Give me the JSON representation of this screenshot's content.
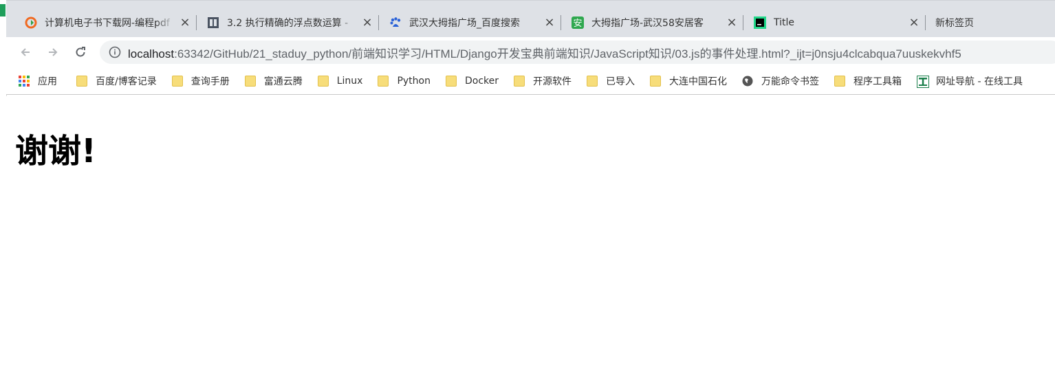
{
  "tabs": [
    {
      "title": "计算机电子书下载网-编程pdf",
      "icon": "chrome-refresh-orange-icon"
    },
    {
      "title": "3.2 执行精确的浮点数运算 - ",
      "icon": "book-icon"
    },
    {
      "title": "武汉大拇指广场_百度搜索",
      "icon": "baidu-paw-icon"
    },
    {
      "title": "大拇指广场-武汉58安居客",
      "icon": "anjuke-green-icon"
    },
    {
      "title": "Title",
      "icon": "pycharm-icon"
    },
    {
      "title": "新标签页",
      "icon": ""
    }
  ],
  "toolbar": {
    "url_host": "localhost",
    "url_rest": ":63342/GitHub/21_staduy_python/前端知识学习/HTML/Django开发宝典前端知识/JavaScript知识/03.js的事件处理.html?_ijt=j0nsju4clcabqua7uuskekvhf5"
  },
  "bookmarks": [
    {
      "label": "应用",
      "icon": "apps-grid-icon"
    },
    {
      "label": "百度/博客记录",
      "icon": "folder-icon"
    },
    {
      "label": "查询手册",
      "icon": "folder-icon"
    },
    {
      "label": "富通云腾",
      "icon": "folder-icon"
    },
    {
      "label": "Linux",
      "icon": "folder-icon"
    },
    {
      "label": "Python",
      "icon": "folder-icon"
    },
    {
      "label": "Docker",
      "icon": "folder-icon"
    },
    {
      "label": "开源软件",
      "icon": "folder-icon"
    },
    {
      "label": "已导入",
      "icon": "folder-icon"
    },
    {
      "label": "大连中国石化",
      "icon": "folder-icon"
    },
    {
      "label": "万能命令书签",
      "icon": "globe-icon"
    },
    {
      "label": "程序工具箱",
      "icon": "folder-icon"
    },
    {
      "label": "网址导航 - 在线工具",
      "icon": "tool-t-icon"
    }
  ],
  "page": {
    "heading": "谢谢!"
  }
}
